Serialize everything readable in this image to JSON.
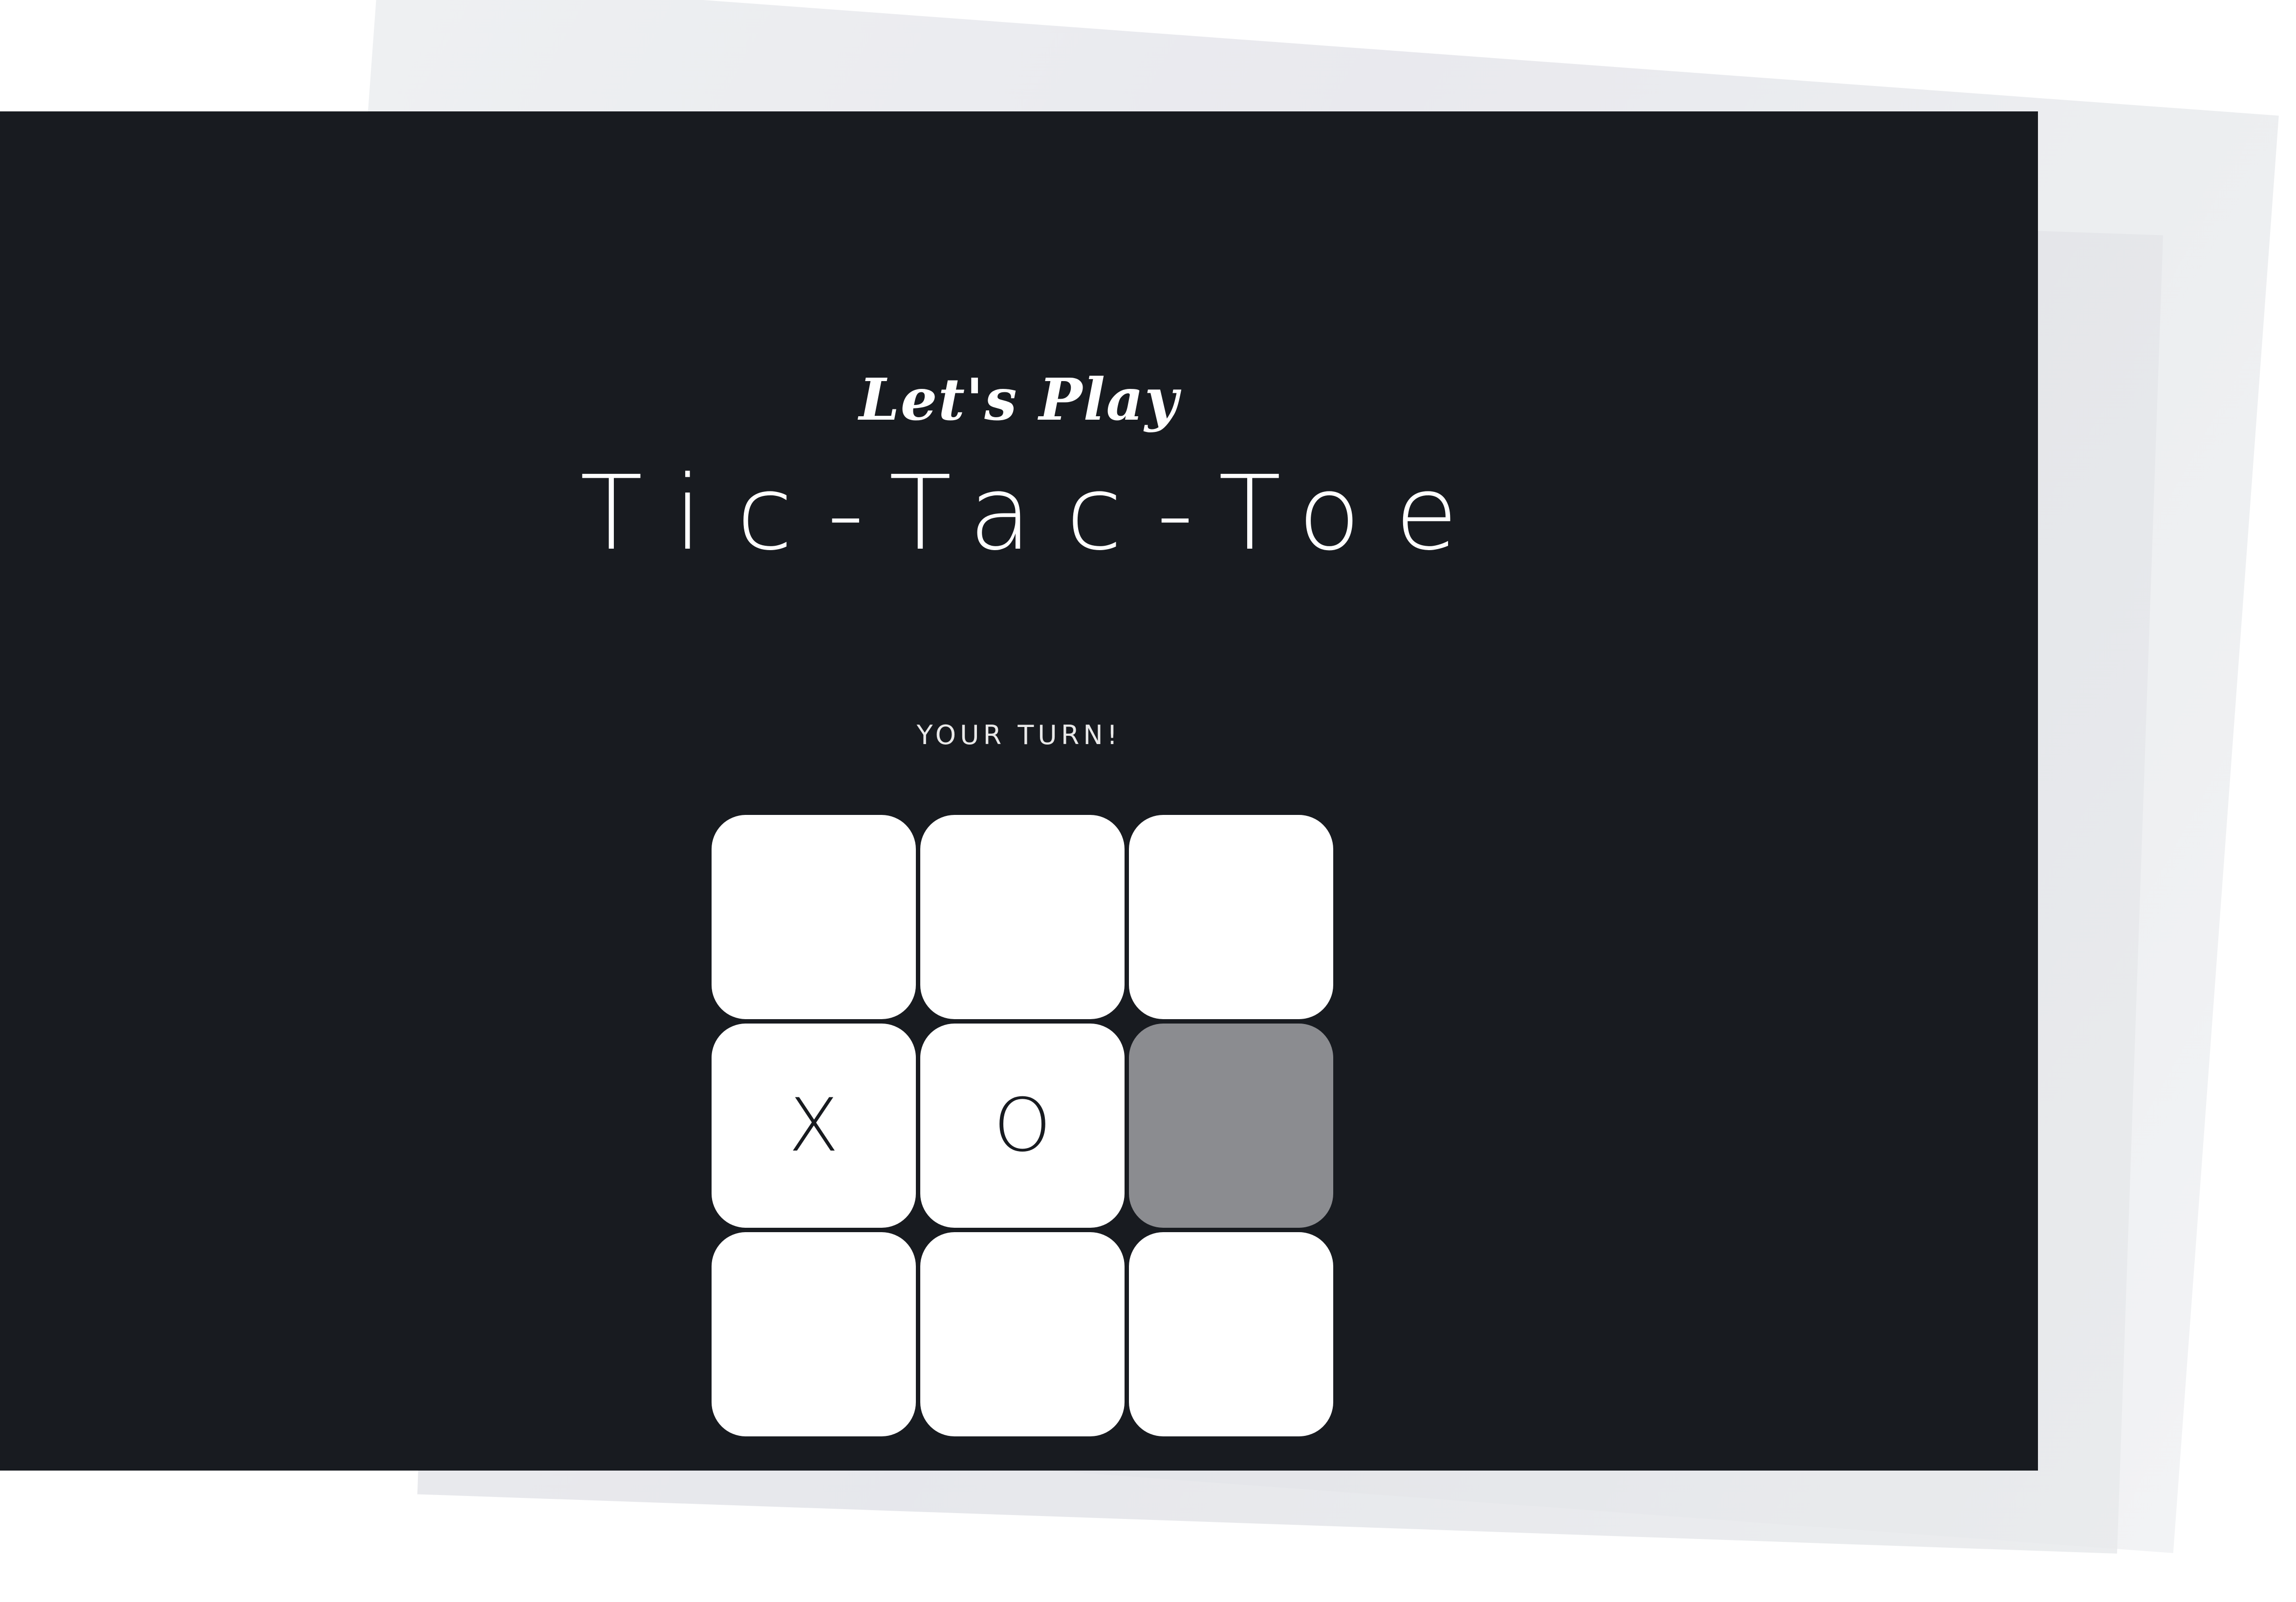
{
  "header": {
    "subtitle": "Let's Play",
    "title": "Tic-Tac-Toe"
  },
  "status": {
    "text": "YOUR TURN!"
  },
  "board": {
    "cells": [
      {
        "mark": "",
        "state": "empty"
      },
      {
        "mark": "",
        "state": "empty"
      },
      {
        "mark": "",
        "state": "empty"
      },
      {
        "mark": "X",
        "state": "filled"
      },
      {
        "mark": "O",
        "state": "filled"
      },
      {
        "mark": "",
        "state": "hover"
      },
      {
        "mark": "",
        "state": "empty"
      },
      {
        "mark": "",
        "state": "empty"
      },
      {
        "mark": "",
        "state": "empty"
      }
    ]
  },
  "colors": {
    "card_background": "#181b20",
    "cell_background": "#ffffff",
    "cell_hover": "#8b8c90",
    "text": "#ffffff"
  }
}
